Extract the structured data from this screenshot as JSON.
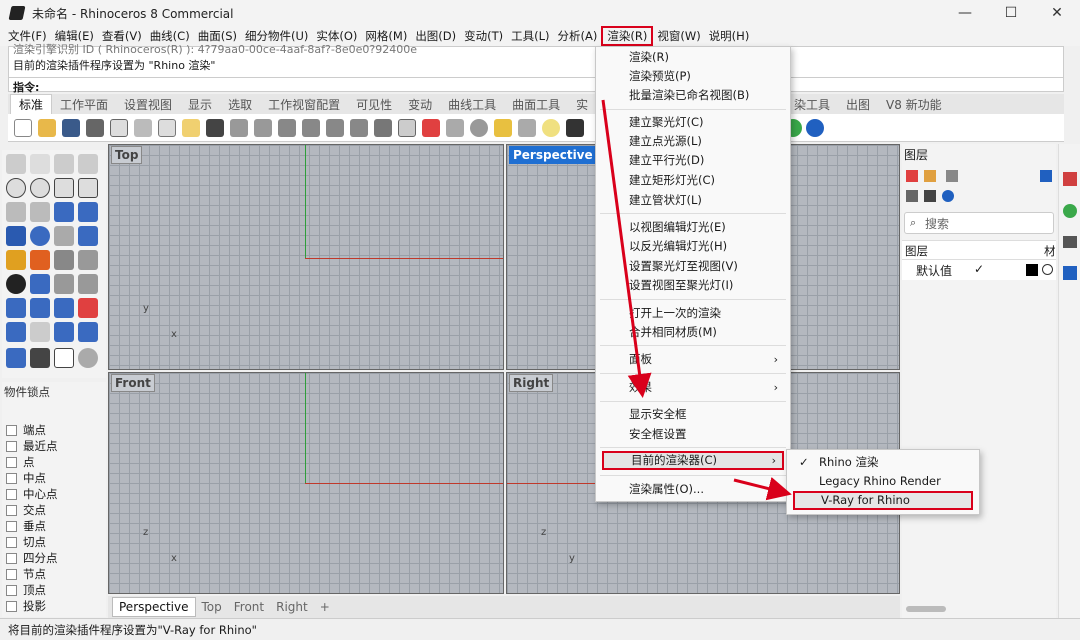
{
  "window": {
    "title": "未命名 - Rhinoceros 8 Commercial",
    "minimize_glyph": "—",
    "maximize_glyph": "☐",
    "close_glyph": "✕"
  },
  "menubar": {
    "items": [
      "文件(F)",
      "编辑(E)",
      "查看(V)",
      "曲线(C)",
      "曲面(S)",
      "细分物件(U)",
      "实体(O)",
      "网格(M)",
      "出图(D)",
      "变动(T)",
      "工具(L)",
      "分析(A)",
      "渲染(R)",
      "视窗(W)",
      "说明(H)"
    ],
    "active_index": 12
  },
  "command": {
    "history_line1": "渲染引擎识别 ID ( Rhinoceros(R) ): 4?79aa0-00ce-4aaf-8af?-8e0e0?92400e",
    "history_line2": "目前的渲染插件程序设置为 \"Rhino 渲染\"",
    "prompt": "指令:"
  },
  "tabs": {
    "items": [
      "标准",
      "工作平面",
      "设置视图",
      "显示",
      "选取",
      "工作视窗配置",
      "可见性",
      "变动",
      "曲线工具",
      "曲面工具",
      "实"
    ],
    "active_index": 0,
    "right_items": [
      "染工具",
      "出图",
      "V8 新功能"
    ]
  },
  "viewports": {
    "top": "Top",
    "perspective": "Perspective",
    "front": "Front",
    "right": "Right",
    "axis_x": "x",
    "axis_y": "y",
    "axis_z": "z"
  },
  "viewport_tabs": {
    "items": [
      "Perspective",
      "Top",
      "Front",
      "Right"
    ],
    "add": "+",
    "active_index": 0
  },
  "osnap": {
    "title": "物件锁点",
    "items": [
      "端点",
      "最近点",
      "点",
      "中点",
      "中心点",
      "交点",
      "垂点",
      "切点",
      "四分点",
      "节点",
      "顶点",
      "投影"
    ]
  },
  "layers": {
    "title": "图层",
    "search_placeholder": "搜索",
    "col_layer": "图层",
    "col_material": "材",
    "default_layer": "默认值",
    "check": "✓"
  },
  "render_menu": {
    "items": [
      {
        "label": "渲染(R)"
      },
      {
        "label": "渲染预览(P)"
      },
      {
        "label": "批量渲染已命名视图(B)"
      },
      {
        "label": "建立聚光灯(C)"
      },
      {
        "label": "建立点光源(L)"
      },
      {
        "label": "建立平行光(D)"
      },
      {
        "label": "建立矩形灯光(C)"
      },
      {
        "label": "建立管状灯(L)"
      },
      {
        "label": "以视图编辑灯光(E)"
      },
      {
        "label": "以反光编辑灯光(H)"
      },
      {
        "label": "设置聚光灯至视图(V)"
      },
      {
        "label": "设置视图至聚光灯(I)"
      },
      {
        "label": "打开上一次的渲染"
      },
      {
        "label": "合并相同材质(M)"
      },
      {
        "label": "面板"
      },
      {
        "label": "效果"
      },
      {
        "label": "显示安全框"
      },
      {
        "label": "安全框设置"
      },
      {
        "label": "目前的渲染器(C)"
      },
      {
        "label": "渲染属性(O)..."
      }
    ],
    "submenu_arrow": "›"
  },
  "renderer_submenu": {
    "items": [
      "Rhino 渲染",
      "Legacy Rhino Render",
      "V-Ray for Rhino"
    ],
    "checked_index": 0,
    "highlight_index": 2,
    "check": "✓"
  },
  "status": {
    "text": "将目前的渲染插件程序设置为\"V-Ray for Rhino\""
  },
  "colors": {
    "annotation_red": "#d9001b",
    "active_viewport": "#1f6fd2"
  }
}
